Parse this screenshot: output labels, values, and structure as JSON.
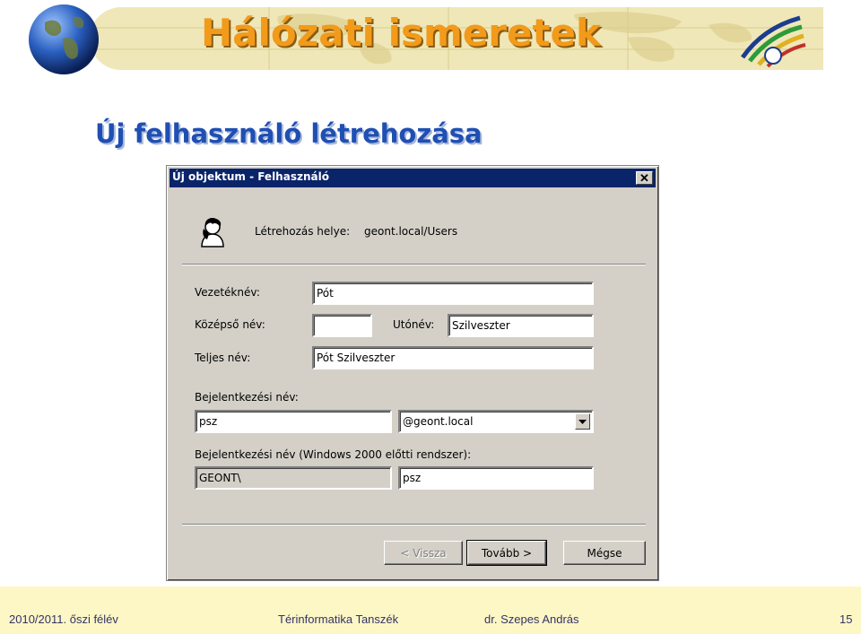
{
  "header": {
    "title": "Hálózati ismeretek",
    "globe_icon": "globe-icon",
    "logo_icon": "institution-logo-icon"
  },
  "slide": {
    "title": "Új felhasználó létrehozása"
  },
  "dialog": {
    "title": "Új objektum - Felhasználó",
    "close_glyph": "✕",
    "location_label": "Létrehozás helye:",
    "location_value": "geont.local/Users",
    "lastname_label": "Vezetéknév:",
    "lastname_value": "Pót",
    "initials_label": "Középső név:",
    "initials_value": "",
    "firstname_label": "Utónév:",
    "firstname_value": "Szilveszter",
    "fullname_label": "Teljes név:",
    "fullname_value": "Pót Szilveszter",
    "logon_label": "Bejelentkezési név:",
    "logon_value": "psz",
    "domain_value": "@geont.local",
    "prewin_label": "Bejelentkezési név (Windows 2000 előtti rendszer):",
    "prewin_domain_value": "GEONT\\",
    "prewin_user_value": "psz",
    "back_button": "< Vissza",
    "next_button": "Tovább >",
    "cancel_button": "Mégse"
  },
  "footer": {
    "semester": "2010/2011. őszi félév",
    "department": "Térinformatika Tanszék",
    "author": "dr. Szepes András",
    "page_number": "15"
  },
  "colors": {
    "title_orange": "#f29a1a",
    "slide_title_blue": "#1f4fb3",
    "titlebar_blue": "#0a246a",
    "dialog_gray": "#d4d0c8",
    "footer_bg": "#fdf7c6"
  }
}
